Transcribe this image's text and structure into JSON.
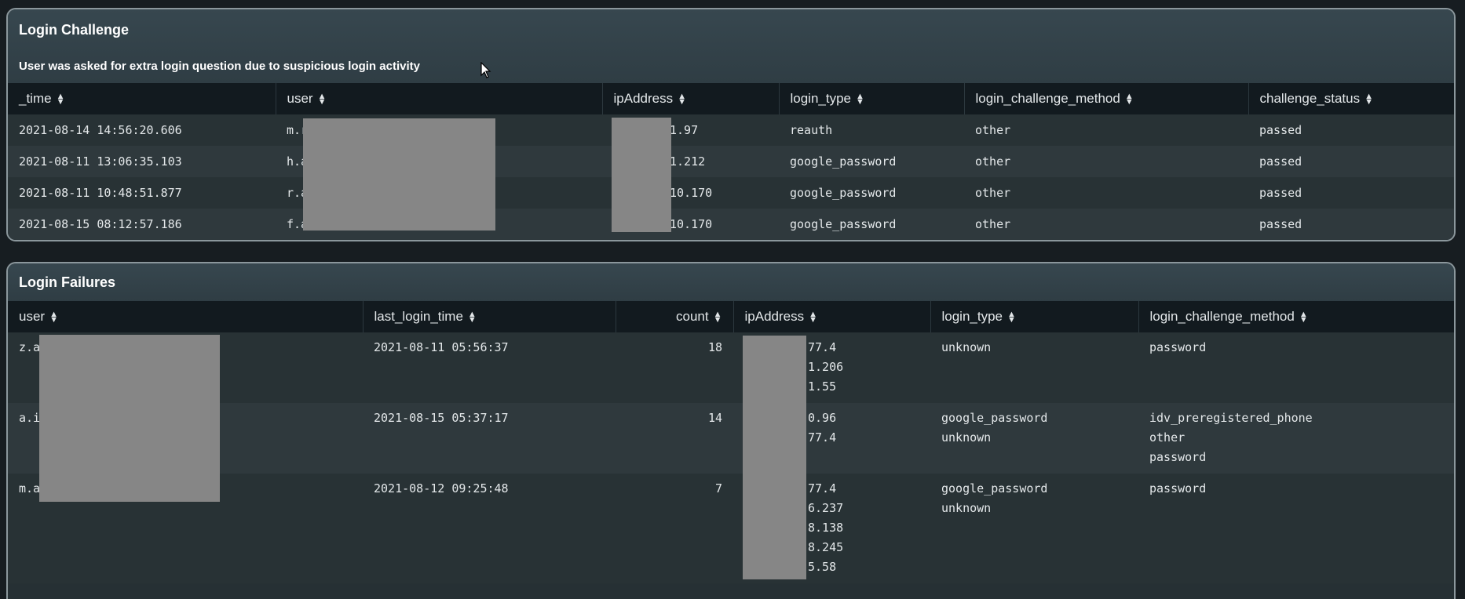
{
  "login_challenge": {
    "title": "Login Challenge",
    "description": "User was asked for extra login question due to suspicious login activity",
    "columns": [
      "_time",
      "user",
      "ipAddress",
      "login_type",
      "login_challenge_method",
      "challenge_status"
    ],
    "rows": [
      {
        "time": "2021-08-14 14:56:20.606",
        "user": "m.r",
        "ip": "1.97",
        "login_type": "reauth",
        "method": "other",
        "status": "passed"
      },
      {
        "time": "2021-08-11 13:06:35.103",
        "user": "h.a",
        "ip": "1.212",
        "login_type": "google_password",
        "method": "other",
        "status": "passed"
      },
      {
        "time": "2021-08-11 10:48:51.877",
        "user": "r.a",
        "ip": "10.170",
        "login_type": "google_password",
        "method": "other",
        "status": "passed"
      },
      {
        "time": "2021-08-15 08:12:57.186",
        "user": "f.a",
        "ip": "10.170",
        "login_type": "google_password",
        "method": "other",
        "status": "passed"
      }
    ]
  },
  "login_failures": {
    "title": "Login Failures",
    "columns": [
      "user",
      "last_login_time",
      "count",
      "ipAddress",
      "login_type",
      "login_challenge_method"
    ],
    "rows": [
      {
        "user": "z.a",
        "last_login_time": "2021-08-11 05:56:37",
        "count": "18",
        "ips": [
          "77.4",
          "1.206",
          "1.55"
        ],
        "login_types": [
          "unknown"
        ],
        "methods": [
          "password"
        ]
      },
      {
        "user": "a.i",
        "last_login_time": "2021-08-15 05:37:17",
        "count": "14",
        "ips": [
          "0.96",
          "77.4"
        ],
        "login_types": [
          "google_password",
          "unknown"
        ],
        "methods": [
          "idv_preregistered_phone",
          "other",
          "password"
        ]
      },
      {
        "user": "m.a",
        "last_login_time": "2021-08-12 09:25:48",
        "count": "7",
        "ips": [
          "77.4",
          "6.237",
          "8.138",
          "8.245",
          "5.58"
        ],
        "login_types": [
          "google_password",
          "unknown"
        ],
        "methods": [
          "password"
        ]
      }
    ]
  },
  "colors": {
    "background": "#171d21",
    "panel_header": "#37474f",
    "table_header": "#121a1f",
    "redaction": "#868686"
  }
}
